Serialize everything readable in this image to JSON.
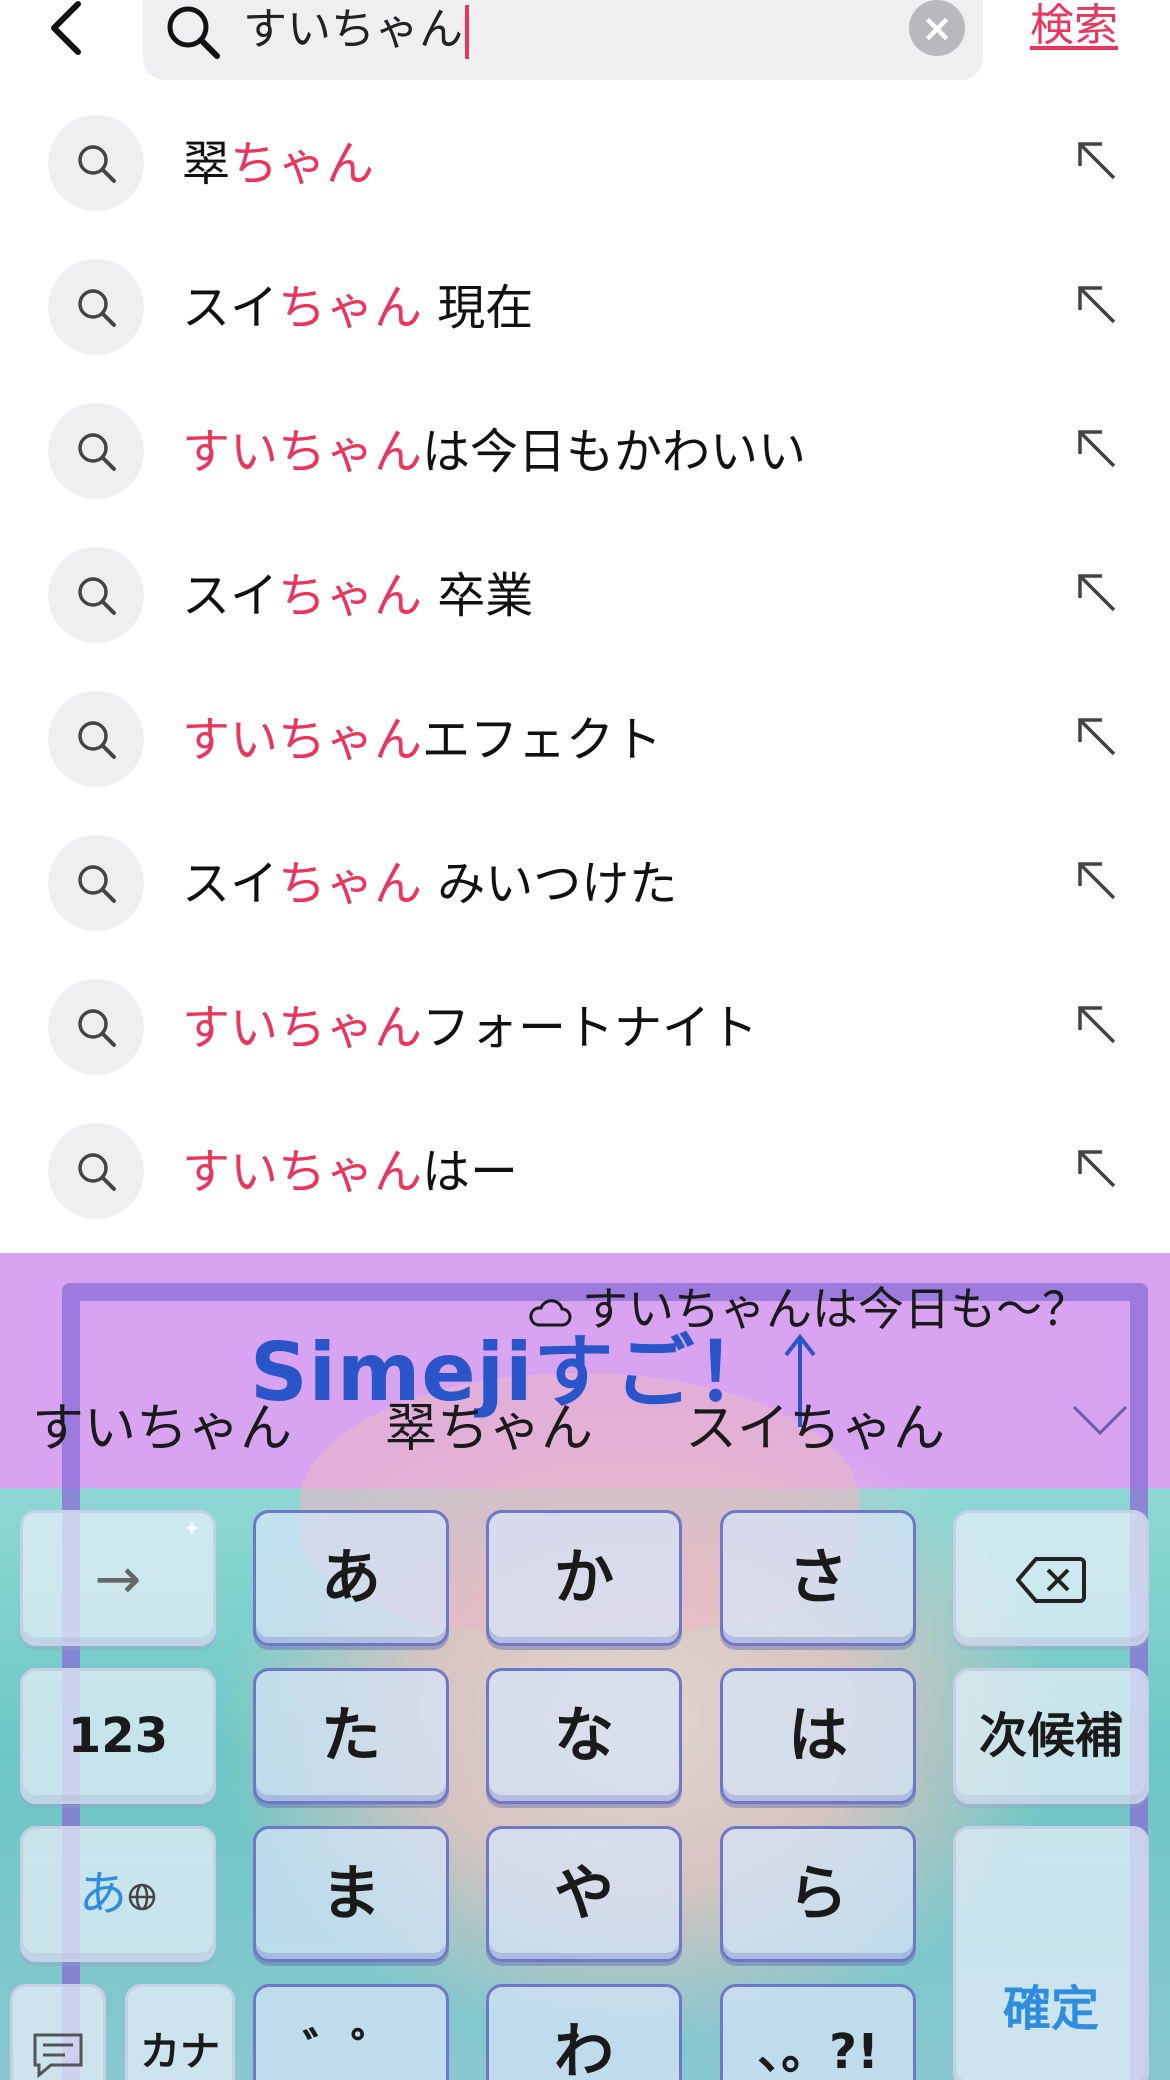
{
  "search": {
    "query": "すいちゃん",
    "action_label": "検索"
  },
  "suggestions": [
    {
      "highlight_prefix": "",
      "plain_prefix": "翠",
      "highlight": "ちゃん",
      "rest": ""
    },
    {
      "highlight_prefix": "",
      "plain_prefix": "スイ",
      "highlight": "ちゃん",
      "rest": " 現在"
    },
    {
      "highlight_prefix": "すいちゃん",
      "plain_prefix": "",
      "highlight": "",
      "rest": "は今日もかわいい"
    },
    {
      "highlight_prefix": "",
      "plain_prefix": "スイ",
      "highlight": "ちゃん",
      "rest": " 卒業"
    },
    {
      "highlight_prefix": "すいちゃん",
      "plain_prefix": "",
      "highlight": "",
      "rest": "エフェクト"
    },
    {
      "highlight_prefix": "",
      "plain_prefix": "スイ",
      "highlight": "ちゃん",
      "rest": " みいつけた"
    },
    {
      "highlight_prefix": "すいちゃん",
      "plain_prefix": "",
      "highlight": "",
      "rest": "フォートナイト"
    },
    {
      "highlight_prefix": "すいちゃん",
      "plain_prefix": "",
      "highlight": "",
      "rest": "はー"
    }
  ],
  "keyboard": {
    "tip": "すいちゃんは今日も〜？",
    "banner": "Simejiすご！",
    "candidates": [
      "すいちゃん",
      "翠ちゃん",
      "スイちゃん"
    ],
    "keys": {
      "arrow": "→",
      "a": "あ",
      "ka": "か",
      "sa": "さ",
      "num": "123",
      "ta": "た",
      "na": "な",
      "ha": "は",
      "next_candidate": "次候補",
      "mode": "あ",
      "ma": "ま",
      "ya": "や",
      "ra": "ら",
      "confirm": "確定",
      "kana": "カナ",
      "dakuten": "゛゜",
      "wa": "わ",
      "punct": "、。?!"
    }
  },
  "colors": {
    "accent": "#e8365e",
    "key_border": "#6d78c8",
    "banner": "#2a55c9",
    "candidate_bar": "#d8a4f2"
  }
}
